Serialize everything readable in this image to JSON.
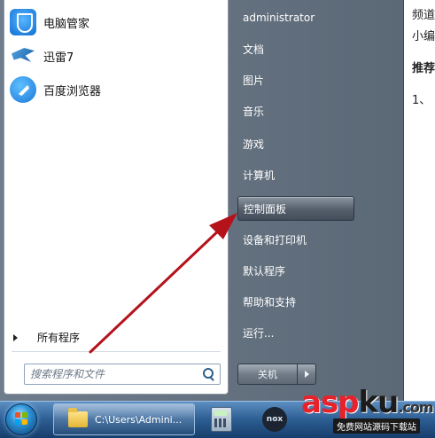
{
  "start_menu": {
    "pinned_programs": [
      {
        "label": "电脑管家",
        "icon": "shield-icon"
      },
      {
        "label": "迅雷7",
        "icon": "bird-icon"
      },
      {
        "label": "百度浏览器",
        "icon": "browser-icon"
      }
    ],
    "all_programs_label": "所有程序",
    "search_placeholder": "搜索程序和文件",
    "right_items": [
      {
        "label": "administrator",
        "kind": "user"
      },
      {
        "label": "文档"
      },
      {
        "label": "图片"
      },
      {
        "label": "音乐"
      },
      {
        "label": "游戏"
      },
      {
        "label": "计算机"
      },
      {
        "label": "控制面板",
        "highlighted": true
      },
      {
        "label": "设备和打印机"
      },
      {
        "label": "默认程序"
      },
      {
        "label": "帮助和支持"
      },
      {
        "label": "运行..."
      }
    ],
    "shutdown_label": "关机"
  },
  "taskbar": {
    "explorer_path": "C:\\Users\\Admini...",
    "nox_label": "nox"
  },
  "article": {
    "line1": "频道",
    "line2": "小编",
    "line3": "推荐",
    "line4": "1、"
  },
  "watermark": {
    "text_main": "asp",
    "text_ku": "ku",
    "suffix": ".com",
    "subtitle": "免费网站源码下载站"
  },
  "colors": {
    "annotation_arrow": "#b5121b",
    "taskbar": "#2c5d92"
  }
}
